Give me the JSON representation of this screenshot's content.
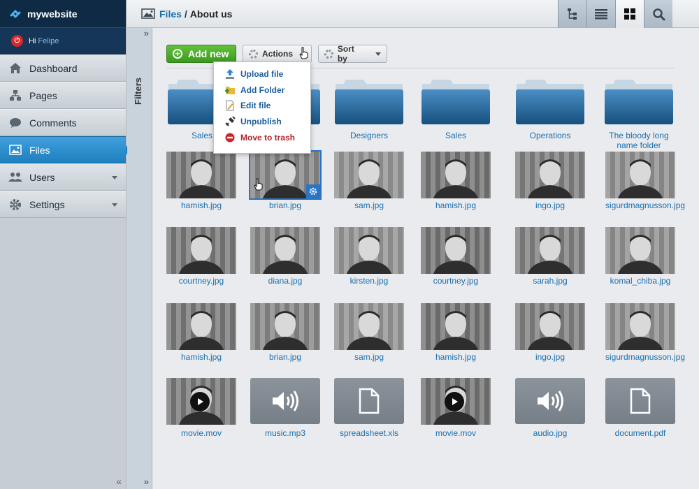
{
  "brand": {
    "name": "mywebsite"
  },
  "user": {
    "greeting": "Hi",
    "name": "Felipe"
  },
  "sidebar": {
    "items": [
      {
        "label": "Dashboard",
        "icon": "house-icon",
        "active": false,
        "has_caret": false
      },
      {
        "label": "Pages",
        "icon": "sitemap-icon",
        "active": false,
        "has_caret": false
      },
      {
        "label": "Comments",
        "icon": "speech-bubble-icon",
        "active": false,
        "has_caret": false
      },
      {
        "label": "Files",
        "icon": "image-icon",
        "active": true,
        "has_caret": false
      },
      {
        "label": "Users",
        "icon": "users-icon",
        "active": false,
        "has_caret": true
      },
      {
        "label": "Settings",
        "icon": "gear-icon",
        "active": false,
        "has_caret": true
      }
    ]
  },
  "breadcrumb": {
    "link": "Files",
    "separator": "/",
    "current": "About us"
  },
  "filters": {
    "label": "Filters"
  },
  "toolbar": {
    "add_new": "Add new",
    "actions": "Actions",
    "sort_by": "Sort by"
  },
  "actions_menu": [
    {
      "label": "Upload file",
      "icon": "upload-icon"
    },
    {
      "label": "Add Folder",
      "icon": "add-folder-icon"
    },
    {
      "label": "Edit file",
      "icon": "edit-file-icon"
    },
    {
      "label": "Unpublish",
      "icon": "unplug-icon"
    },
    {
      "label": "Move to trash",
      "icon": "trash-icon"
    }
  ],
  "folders": [
    {
      "name": "Sales"
    },
    {
      "name": ""
    },
    {
      "name": "Designers"
    },
    {
      "name": "Sales"
    },
    {
      "name": "Operations"
    },
    {
      "name": "The bloody long name folder"
    }
  ],
  "files": {
    "row1": [
      "hamish.jpg",
      "brian.jpg",
      "sam.jpg",
      "hamish.jpg",
      "ingo.jpg",
      "sigurdmagnusson.jpg"
    ],
    "row2": [
      "courtney.jpg",
      "diana.jpg",
      "kirsten.jpg",
      "courtney.jpg",
      "sarah.jpg",
      "komal_chiba.jpg"
    ],
    "row3": [
      "hamish.jpg",
      "brian.jpg",
      "sam.jpg",
      "hamish.jpg",
      "ingo.jpg",
      "sigurdmagnusson.jpg"
    ],
    "row4": [
      "movie.mov",
      "music.mp3",
      "spreadsheet.xls",
      "movie.mov",
      "audio.jpg",
      "document.pdf"
    ]
  },
  "colors": {
    "accent": "#1f7fbf",
    "link": "#1a6fb0",
    "add_green": "#4caf2a",
    "danger": "#b3262b",
    "navy": "#0f2a44"
  }
}
